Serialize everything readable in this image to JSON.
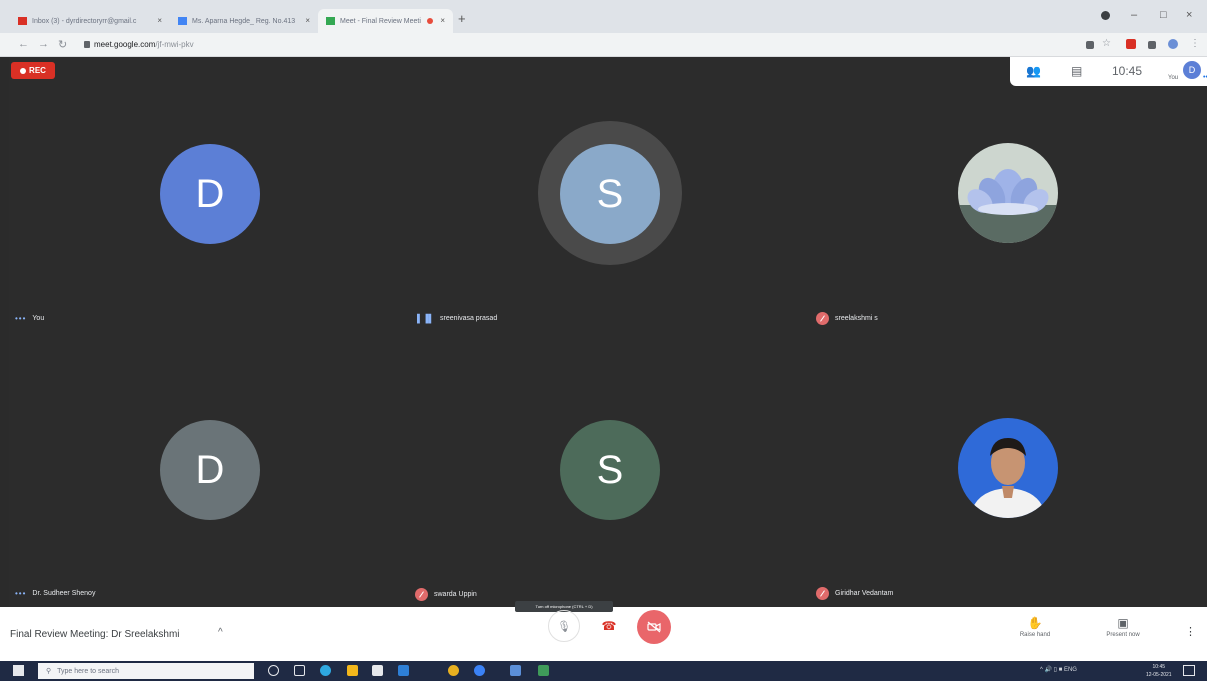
{
  "browser": {
    "tabs": [
      {
        "title": "Inbox (3) - dyrdirectoryrr@gmail.c",
        "close": "×",
        "color": "#d93025"
      },
      {
        "title": "Ms. Aparna Hegde_ Reg. No.413",
        "close": "×",
        "color": "#4285f4"
      },
      {
        "title": "Meet - Final Review Meeti",
        "close": "×",
        "color": "#34a853"
      }
    ],
    "new_tab": "+",
    "window_controls": [
      "–",
      "□",
      "×"
    ],
    "url_host": "meet.google.com",
    "url_path": "/jf-mwi-pkv"
  },
  "meeting": {
    "rec_label": "REC",
    "clock": "10:45",
    "you_label": "You",
    "self_initial": "D",
    "participants": [
      {
        "name": "You",
        "initial": "D",
        "color": "#5c7fd6"
      },
      {
        "name": "sreenivasa prasad",
        "initial": "S",
        "color": "#8aa9c9"
      },
      {
        "name": "sreelakshmi s",
        "initial": "",
        "color": ""
      },
      {
        "name": "Dr. Sudheer Shenoy",
        "initial": "D",
        "color": "#6a7478"
      },
      {
        "name": "swarda Uppin",
        "initial": "S",
        "color": "#4d6b5a"
      },
      {
        "name": "Giridhar Vedantam",
        "initial": "",
        "color": ""
      }
    ],
    "title": "Final Review Meeting: Dr Sreelakshmi",
    "mic_tooltip": "Turn off microphone (CTRL + D)",
    "raise_hand": "Raise hand",
    "present_now": "Present now"
  },
  "taskbar": {
    "search_placeholder": "Type here to search",
    "lang": "ENG",
    "time": "10:45",
    "date": "12-05-2021"
  }
}
